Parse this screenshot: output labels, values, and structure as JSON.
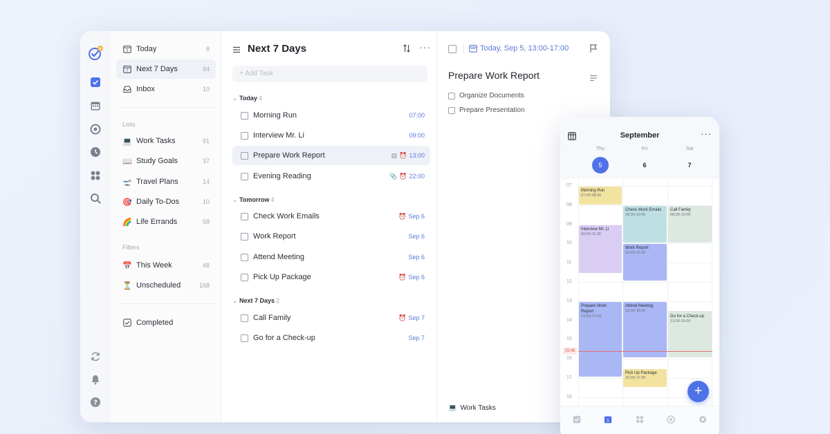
{
  "sidebar": {
    "items": [
      {
        "label": "Today",
        "count": "8",
        "icon": "calendar-day-icon"
      },
      {
        "label": "Next 7 Days",
        "count": "94",
        "icon": "calendar-week-icon"
      },
      {
        "label": "Inbox",
        "count": "10",
        "icon": "inbox-icon"
      }
    ],
    "lists_header": "Lists",
    "lists": [
      {
        "emoji": "💻",
        "label": "Work Tasks",
        "count": "91"
      },
      {
        "emoji": "📖",
        "label": "Study Goals",
        "count": "37"
      },
      {
        "emoji": "🛫",
        "label": "Travel Plans",
        "count": "14"
      },
      {
        "emoji": "🎯",
        "label": "Daily To-Dos",
        "count": "10"
      },
      {
        "emoji": "🌈",
        "label": "Life Errands",
        "count": "58"
      }
    ],
    "filters_header": "Filters",
    "filters": [
      {
        "emoji": "📅",
        "label": "This Week",
        "count": "48"
      },
      {
        "emoji": "⏳",
        "label": "Unscheduled",
        "count": "168"
      }
    ],
    "completed_label": "Completed"
  },
  "tasks": {
    "title": "Next 7 Days",
    "add_placeholder": "+ Add Task",
    "sections": [
      {
        "name": "Today",
        "count": "4",
        "rows": [
          {
            "title": "Morning Run",
            "meta": "07:00"
          },
          {
            "title": "Interview Mr. Li",
            "meta": "09:00"
          },
          {
            "title": "Prepare Work Report",
            "meta": "13:00"
          },
          {
            "title": "Evening Reading",
            "meta": "22:00"
          }
        ]
      },
      {
        "name": "Tomorrow",
        "count": "4",
        "rows": [
          {
            "title": "Check Work Emails",
            "meta": "Sep 6"
          },
          {
            "title": "Work Report",
            "meta": "Sep 6"
          },
          {
            "title": "Attend Meeting",
            "meta": "Sep 6"
          },
          {
            "title": "Pick Up Package",
            "meta": "Sep 6"
          }
        ]
      },
      {
        "name": "Next 7 Days",
        "count": "2",
        "rows": [
          {
            "title": "Call Family",
            "meta": "Sep 7"
          },
          {
            "title": "Go for a Check-up",
            "meta": "Sep 7"
          }
        ]
      }
    ]
  },
  "detail": {
    "date": "Today, Sep 5, 13:00-17:00",
    "title": "Prepare Work Report",
    "subtasks": [
      "Organize Documents",
      "Prepare Presentation"
    ],
    "list_emoji": "💻",
    "list_name": "Work Tasks"
  },
  "phone": {
    "month": "September",
    "weekdays": [
      "Thu",
      "Fri",
      "Sat"
    ],
    "days": [
      "5",
      "6",
      "7"
    ],
    "hours": [
      "07",
      "08",
      "09",
      "10",
      "11",
      "12",
      "13",
      "14",
      "15",
      "16",
      "17",
      "18"
    ],
    "now": "15:45",
    "events": [
      {
        "title": "Morning Run",
        "time": "07:00-08:00"
      },
      {
        "title": "Interview Mr. Li",
        "time": "09:00-11:30"
      },
      {
        "title": "Prepare Work Report",
        "time": "13:00-17:00"
      },
      {
        "title": "Check Work Emails",
        "time": "08:00-10:00"
      },
      {
        "title": "Work Report",
        "time": "10:00-12:00"
      },
      {
        "title": "Attend Meeting",
        "time": "13:00-16:00"
      },
      {
        "title": "Pick Up Package",
        "time": "16:30-17:30"
      },
      {
        "title": "Call Family",
        "time": "08:00-10:00"
      },
      {
        "title": "Go for a Check-up",
        "time": "13:30-16:00"
      }
    ],
    "fab": "+"
  },
  "colors": {
    "accent": "#4f72e8",
    "event_yellow": "#f3e3a0",
    "event_purple": "#d9cdf3",
    "event_blue": "#a9b7f5",
    "event_teal": "#bfe0e3",
    "event_green": "#dde8e0",
    "now_red": "#e57373"
  }
}
